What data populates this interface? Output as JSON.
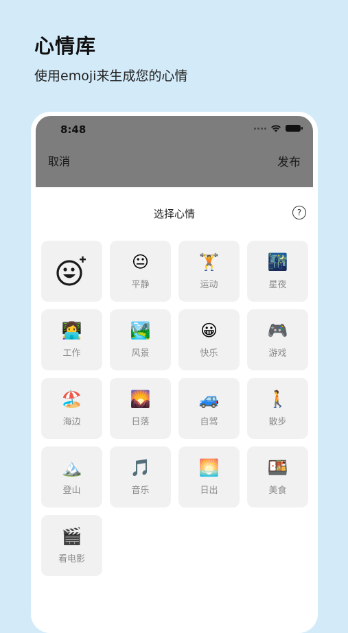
{
  "promo": {
    "title": "心情库",
    "subtitle": "使用emoji来生成您的心情"
  },
  "status_bar": {
    "time": "8:48"
  },
  "nav": {
    "cancel": "取消",
    "publish": "发布"
  },
  "sheet": {
    "title": "选择心情",
    "help": "?"
  },
  "moods": [
    {
      "emoji": "😐",
      "label": "平静"
    },
    {
      "emoji": "🏋️",
      "label": "运动"
    },
    {
      "emoji": "🌃",
      "label": "星夜"
    },
    {
      "emoji": "👩‍💻",
      "label": "工作"
    },
    {
      "emoji": "🏞️",
      "label": "风景"
    },
    {
      "emoji": "😀",
      "label": "快乐"
    },
    {
      "emoji": "🎮",
      "label": "游戏"
    },
    {
      "emoji": "🏖️",
      "label": "海边"
    },
    {
      "emoji": "🌄",
      "label": "日落"
    },
    {
      "emoji": "🚙",
      "label": "自驾"
    },
    {
      "emoji": "🚶",
      "label": "散步"
    },
    {
      "emoji": "🏔️",
      "label": "登山"
    },
    {
      "emoji": "🎵",
      "label": "音乐"
    },
    {
      "emoji": "🌅",
      "label": "日出"
    },
    {
      "emoji": "🍱",
      "label": "美食"
    },
    {
      "emoji": "🎬",
      "label": "看电影"
    }
  ]
}
